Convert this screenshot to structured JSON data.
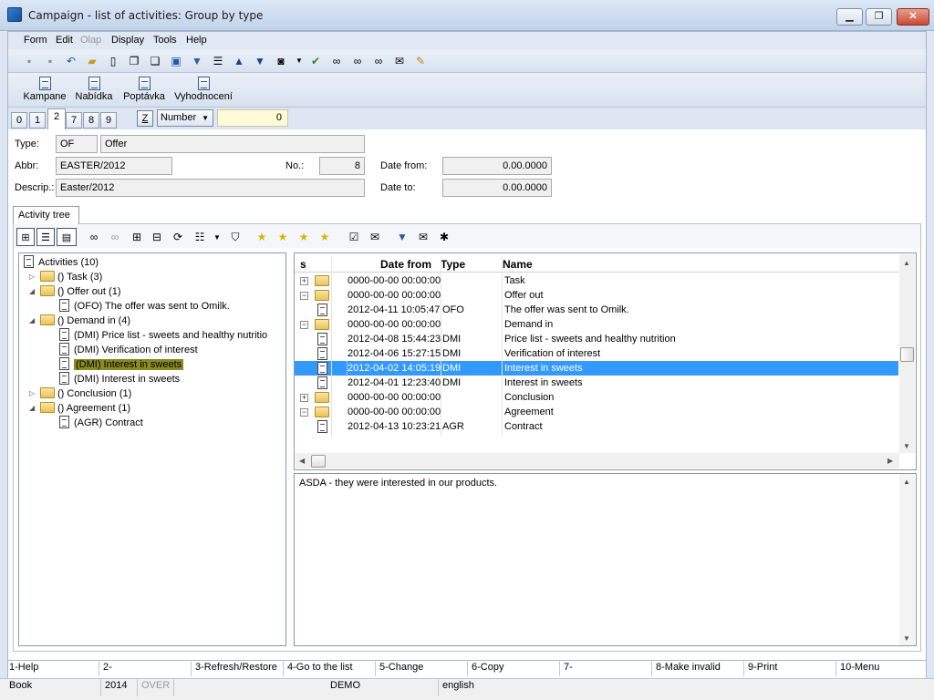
{
  "window": {
    "title": "Campaign - list of activities: Group by type",
    "min": "▁",
    "max": "❐",
    "close": "✕"
  },
  "menu": [
    "Form",
    "Edit",
    "Olap",
    "Display",
    "Tools",
    "Help"
  ],
  "toolbar_icons": [
    "save-icon",
    "save-as-icon",
    "undo-icon",
    "open-folder-icon",
    "new-document-icon",
    "copy-icon",
    "paste-icon",
    "book-icon",
    "filter-icon",
    "filter-list-icon",
    "arrow-up-icon",
    "arrow-down-icon",
    "camera-icon",
    "dropdown-icon",
    "check-icon",
    "binoculars-icon",
    "find-next-icon",
    "find-all-icon",
    "mail-icon",
    "notes-icon"
  ],
  "big_buttons": [
    "Kampane",
    "Nabídka",
    "Poptávka",
    "Vyhodnocení"
  ],
  "tabs": [
    "0",
    "1",
    "2",
    "7",
    "8",
    "9"
  ],
  "sort": {
    "z_label": "Z",
    "field": "Number",
    "value": "0"
  },
  "form": {
    "type_label": "Type:",
    "type_code": "OF",
    "type_name": "Offer",
    "abbr_label": "Abbr:",
    "abbr_value": "EASTER/2012",
    "no_label": "No.:",
    "no_value": "8",
    "date_from_label": "Date from:",
    "date_from_value": "0.00.0000",
    "descr_label": "Descrip.:",
    "descr_value": "Easter/2012",
    "date_to_label": "Date to:",
    "date_to_value": "0.00.0000"
  },
  "tree_tab": "Activity tree",
  "tree": {
    "root": "Activities (10)",
    "items": [
      {
        "label": "() Task (3)",
        "kind": "folder",
        "level": 1,
        "toggle": "▷"
      },
      {
        "label": "() Offer out (1)",
        "kind": "folder",
        "level": 1,
        "toggle": "◢"
      },
      {
        "label": "(OFO) The offer was sent to Omilk.",
        "kind": "doc",
        "level": 2
      },
      {
        "label": "() Demand in (4)",
        "kind": "folder",
        "level": 1,
        "toggle": "◢"
      },
      {
        "label": "(DMI) Price list - sweets and healthy nutritio",
        "kind": "doc",
        "level": 2
      },
      {
        "label": "(DMI) Verification of interest",
        "kind": "doc",
        "level": 2
      },
      {
        "label": "(DMI) Interest in sweets",
        "kind": "doc",
        "level": 2,
        "selected": true
      },
      {
        "label": "(DMI) Interest in sweets",
        "kind": "doc",
        "level": 2
      },
      {
        "label": "() Conclusion (1)",
        "kind": "folder",
        "level": 1,
        "toggle": "▷"
      },
      {
        "label": "() Agreement (1)",
        "kind": "folder",
        "level": 1,
        "toggle": "◢"
      },
      {
        "label": "(AGR) Contract",
        "kind": "doc",
        "level": 2
      }
    ]
  },
  "grid": {
    "headers": {
      "s": "s",
      "date": "Date from",
      "type": "Type",
      "name": "Name"
    },
    "rows": [
      {
        "toggle": "+",
        "kind": "folder",
        "date": "0000-00-00 00:00:00",
        "type": "",
        "name": "Task"
      },
      {
        "toggle": "−",
        "kind": "folder",
        "date": "0000-00-00 00:00:00",
        "type": "",
        "name": "Offer out"
      },
      {
        "toggle": "",
        "kind": "doc",
        "date": "2012-04-11 10:05:47",
        "type": "OFO",
        "name": "The offer was sent to Omilk."
      },
      {
        "toggle": "−",
        "kind": "folder",
        "date": "0000-00-00 00:00:00",
        "type": "",
        "name": "Demand in"
      },
      {
        "toggle": "",
        "kind": "doc",
        "date": "2012-04-08 15:44:23",
        "type": "DMI",
        "name": "Price list - sweets and healthy nutrition"
      },
      {
        "toggle": "",
        "kind": "doc",
        "date": "2012-04-06 15:27:15",
        "type": "DMI",
        "name": "Verification of interest"
      },
      {
        "toggle": "",
        "kind": "doc",
        "date": "2012-04-02 14:05:19",
        "type": "DMI",
        "name": "Interest in sweets",
        "selected": true
      },
      {
        "toggle": "",
        "kind": "doc",
        "date": "2012-04-01 12:23:40",
        "type": "DMI",
        "name": "Interest in sweets"
      },
      {
        "toggle": "+",
        "kind": "folder",
        "date": "0000-00-00 00:00:00",
        "type": "",
        "name": "Conclusion"
      },
      {
        "toggle": "−",
        "kind": "folder",
        "date": "0000-00-00 00:00:00",
        "type": "",
        "name": "Agreement"
      },
      {
        "toggle": "",
        "kind": "doc",
        "date": "2012-04-13 10:23:21",
        "type": "AGR",
        "name": "Contract"
      }
    ]
  },
  "note": "ASDA - they were interested in our products.",
  "fkeys": [
    "1-Help",
    "2-",
    "3-Refresh/Restore",
    "4-Go to the list",
    "5-Change",
    "6-Copy",
    "7-",
    "8-Make invalid",
    "9-Print",
    "10-Menu"
  ],
  "status": {
    "mode": "Book",
    "year": "2014",
    "over": "OVER",
    "db": "DEMO",
    "lang": "english"
  },
  "colors": {
    "selection": "#3399ff",
    "tree_highlight": "#8a8a20",
    "disabled_text": "#9a9a9a"
  }
}
